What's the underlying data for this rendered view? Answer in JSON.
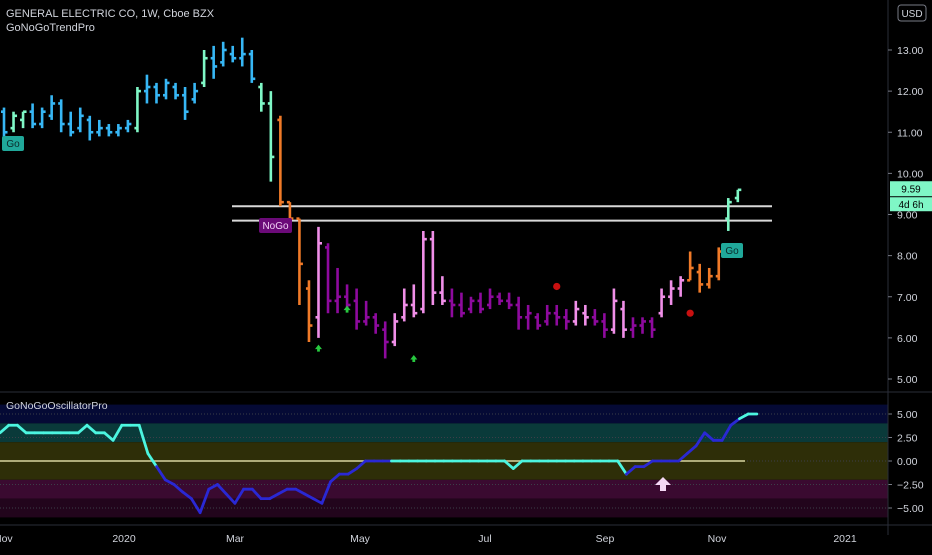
{
  "header": {
    "symbol_line": "GENERAL ELECTRIC CO, 1W, Cboe BZX",
    "indicator": "GoNoGoTrendPro",
    "currency_button": "USD"
  },
  "oscillator": {
    "title": "GoNoGoOscillatorPro"
  },
  "colors": {
    "go_strong": "#37b7f5",
    "go": "#7ff7c6",
    "nogo": "#8e0a9e",
    "nogo_weak": "#f08fe8",
    "nogo_orange": "#f07a28",
    "osc_line_go": "#4cf5e0",
    "osc_line_nogo": "#2a28d4"
  },
  "chart_data": [
    {
      "type": "ohlc",
      "title": "GENERAL ELECTRIC CO, 1W, Cboe BZX",
      "x_labels": [
        "Nov",
        "2020",
        "Mar",
        "May",
        "Jul",
        "Sep",
        "Nov",
        "2021"
      ],
      "y_ticks": [
        5.0,
        6.0,
        7.0,
        8.0,
        9.0,
        10.0,
        11.0,
        12.0,
        13.0
      ],
      "ylim": [
        4.7,
        13.7
      ],
      "last_price": "9.59",
      "countdown": "4d 6h",
      "resistance_zone": [
        8.85,
        9.2
      ],
      "labels": [
        {
          "text": "Go",
          "bar": 0
        },
        {
          "text": "NoGo",
          "bar": 33
        },
        {
          "text": "Go",
          "bar": 104
        }
      ],
      "bars": [
        {
          "h": 11.6,
          "l": 10.8,
          "o": 11.5,
          "c": 11.0,
          "t": "go_strong"
        },
        {
          "h": 11.5,
          "l": 11.0,
          "o": 11.1,
          "c": 11.4,
          "t": "go"
        },
        {
          "h": 11.5,
          "l": 11.1,
          "o": 11.3,
          "c": 11.5,
          "t": "go"
        },
        {
          "h": 11.7,
          "l": 11.1,
          "o": 11.5,
          "c": 11.2,
          "t": "go_strong"
        },
        {
          "h": 11.6,
          "l": 11.1,
          "o": 11.2,
          "c": 11.5,
          "t": "go_strong"
        },
        {
          "h": 11.9,
          "l": 11.3,
          "o": 11.4,
          "c": 11.7,
          "t": "go_strong"
        },
        {
          "h": 11.8,
          "l": 11.0,
          "o": 11.7,
          "c": 11.2,
          "t": "go_strong"
        },
        {
          "h": 11.5,
          "l": 10.9,
          "o": 11.2,
          "c": 11.0,
          "t": "go_strong"
        },
        {
          "h": 11.6,
          "l": 11.0,
          "o": 11.1,
          "c": 11.4,
          "t": "go_strong"
        },
        {
          "h": 11.4,
          "l": 10.8,
          "o": 11.3,
          "c": 11.0,
          "t": "go_strong"
        },
        {
          "h": 11.3,
          "l": 10.9,
          "o": 11.0,
          "c": 11.1,
          "t": "go_strong"
        },
        {
          "h": 11.2,
          "l": 10.9,
          "o": 11.1,
          "c": 11.0,
          "t": "go_strong"
        },
        {
          "h": 11.2,
          "l": 10.9,
          "o": 11.0,
          "c": 11.1,
          "t": "go_strong"
        },
        {
          "h": 11.3,
          "l": 11.0,
          "o": 11.1,
          "c": 11.2,
          "t": "go_strong"
        },
        {
          "h": 12.1,
          "l": 11.0,
          "o": 11.1,
          "c": 12.0,
          "t": "go"
        },
        {
          "h": 12.4,
          "l": 11.7,
          "o": 12.0,
          "c": 12.1,
          "t": "go_strong"
        },
        {
          "h": 12.2,
          "l": 11.7,
          "o": 12.1,
          "c": 11.9,
          "t": "go_strong"
        },
        {
          "h": 12.3,
          "l": 11.8,
          "o": 11.9,
          "c": 12.2,
          "t": "go_strong"
        },
        {
          "h": 12.2,
          "l": 11.8,
          "o": 12.1,
          "c": 11.9,
          "t": "go_strong"
        },
        {
          "h": 12.1,
          "l": 11.3,
          "o": 11.9,
          "c": 11.5,
          "t": "go_strong"
        },
        {
          "h": 12.2,
          "l": 11.7,
          "o": 11.8,
          "c": 12.0,
          "t": "go_strong"
        },
        {
          "h": 13.0,
          "l": 12.1,
          "o": 12.2,
          "c": 12.8,
          "t": "go"
        },
        {
          "h": 13.1,
          "l": 12.3,
          "o": 12.8,
          "c": 12.6,
          "t": "go_strong"
        },
        {
          "h": 13.2,
          "l": 12.6,
          "o": 12.7,
          "c": 13.0,
          "t": "go_strong"
        },
        {
          "h": 13.1,
          "l": 12.7,
          "o": 12.9,
          "c": 12.8,
          "t": "go_strong"
        },
        {
          "h": 13.3,
          "l": 12.6,
          "o": 12.8,
          "c": 12.9,
          "t": "go_strong"
        },
        {
          "h": 13.0,
          "l": 12.2,
          "o": 12.9,
          "c": 12.3,
          "t": "go_strong"
        },
        {
          "h": 12.2,
          "l": 11.5,
          "o": 12.1,
          "c": 11.7,
          "t": "go"
        },
        {
          "h": 12.0,
          "l": 9.8,
          "o": 11.7,
          "c": 10.4,
          "t": "go"
        },
        {
          "h": 11.4,
          "l": 9.2,
          "o": 11.3,
          "c": 9.3,
          "t": "nogo_orange"
        },
        {
          "h": 9.3,
          "l": 8.8,
          "o": 9.3,
          "c": 8.9,
          "t": "nogo_orange"
        },
        {
          "h": 8.9,
          "l": 6.8,
          "o": 8.9,
          "c": 7.8,
          "t": "nogo_orange"
        },
        {
          "h": 7.4,
          "l": 5.9,
          "o": 7.2,
          "c": 6.3,
          "t": "nogo_orange"
        },
        {
          "h": 8.7,
          "l": 6.0,
          "o": 6.5,
          "c": 8.3,
          "t": "nogo_weak"
        },
        {
          "h": 8.3,
          "l": 6.6,
          "o": 8.2,
          "c": 6.9,
          "t": "nogo"
        },
        {
          "h": 7.7,
          "l": 6.6,
          "o": 6.9,
          "c": 7.0,
          "t": "nogo"
        },
        {
          "h": 7.3,
          "l": 6.7,
          "o": 7.0,
          "c": 6.8,
          "t": "nogo"
        },
        {
          "h": 7.2,
          "l": 6.2,
          "o": 6.9,
          "c": 6.4,
          "t": "nogo"
        },
        {
          "h": 6.9,
          "l": 6.3,
          "o": 6.4,
          "c": 6.5,
          "t": "nogo"
        },
        {
          "h": 6.6,
          "l": 6.1,
          "o": 6.5,
          "c": 6.3,
          "t": "nogo"
        },
        {
          "h": 6.4,
          "l": 5.5,
          "o": 6.2,
          "c": 5.9,
          "t": "nogo"
        },
        {
          "h": 6.6,
          "l": 5.8,
          "o": 5.9,
          "c": 6.4,
          "t": "nogo_weak"
        },
        {
          "h": 7.2,
          "l": 6.4,
          "o": 6.5,
          "c": 6.8,
          "t": "nogo_weak"
        },
        {
          "h": 7.3,
          "l": 6.5,
          "o": 6.8,
          "c": 6.6,
          "t": "nogo_weak"
        },
        {
          "h": 8.6,
          "l": 6.6,
          "o": 6.7,
          "c": 8.4,
          "t": "nogo_weak"
        },
        {
          "h": 8.6,
          "l": 6.8,
          "o": 8.4,
          "c": 7.1,
          "t": "nogo_weak"
        },
        {
          "h": 7.5,
          "l": 6.8,
          "o": 7.1,
          "c": 6.9,
          "t": "nogo_weak"
        },
        {
          "h": 7.2,
          "l": 6.5,
          "o": 6.9,
          "c": 6.8,
          "t": "nogo"
        },
        {
          "h": 7.1,
          "l": 6.5,
          "o": 6.8,
          "c": 6.6,
          "t": "nogo"
        },
        {
          "h": 7.0,
          "l": 6.6,
          "o": 6.7,
          "c": 6.9,
          "t": "nogo"
        },
        {
          "h": 7.1,
          "l": 6.6,
          "o": 6.9,
          "c": 6.7,
          "t": "nogo"
        },
        {
          "h": 7.2,
          "l": 6.7,
          "o": 6.8,
          "c": 7.0,
          "t": "nogo"
        },
        {
          "h": 7.1,
          "l": 6.8,
          "o": 7.0,
          "c": 6.9,
          "t": "nogo"
        },
        {
          "h": 7.1,
          "l": 6.7,
          "o": 6.9,
          "c": 6.8,
          "t": "nogo"
        },
        {
          "h": 7.0,
          "l": 6.2,
          "o": 6.8,
          "c": 6.5,
          "t": "nogo"
        },
        {
          "h": 6.8,
          "l": 6.2,
          "o": 6.5,
          "c": 6.6,
          "t": "nogo"
        },
        {
          "h": 6.6,
          "l": 6.2,
          "o": 6.5,
          "c": 6.3,
          "t": "nogo"
        },
        {
          "h": 6.8,
          "l": 6.3,
          "o": 6.4,
          "c": 6.6,
          "t": "nogo"
        },
        {
          "h": 6.8,
          "l": 6.3,
          "o": 6.6,
          "c": 6.5,
          "t": "nogo"
        },
        {
          "h": 6.7,
          "l": 6.2,
          "o": 6.5,
          "c": 6.4,
          "t": "nogo"
        },
        {
          "h": 6.9,
          "l": 6.3,
          "o": 6.4,
          "c": 6.7,
          "t": "nogo_weak"
        },
        {
          "h": 6.8,
          "l": 6.3,
          "o": 6.6,
          "c": 6.5,
          "t": "nogo_weak"
        },
        {
          "h": 6.7,
          "l": 6.3,
          "o": 6.5,
          "c": 6.4,
          "t": "nogo"
        },
        {
          "h": 6.6,
          "l": 6.0,
          "o": 6.4,
          "c": 6.2,
          "t": "nogo"
        },
        {
          "h": 7.2,
          "l": 6.1,
          "o": 6.2,
          "c": 6.9,
          "t": "nogo_weak"
        },
        {
          "h": 6.9,
          "l": 6.0,
          "o": 6.7,
          "c": 6.2,
          "t": "nogo_weak"
        },
        {
          "h": 6.5,
          "l": 6.0,
          "o": 6.2,
          "c": 6.3,
          "t": "nogo"
        },
        {
          "h": 6.5,
          "l": 6.1,
          "o": 6.3,
          "c": 6.4,
          "t": "nogo"
        },
        {
          "h": 6.5,
          "l": 6.0,
          "o": 6.4,
          "c": 6.2,
          "t": "nogo"
        },
        {
          "h": 7.2,
          "l": 6.5,
          "o": 6.6,
          "c": 7.0,
          "t": "nogo_weak"
        },
        {
          "h": 7.4,
          "l": 6.8,
          "o": 7.0,
          "c": 7.2,
          "t": "nogo_weak"
        },
        {
          "h": 7.5,
          "l": 7.0,
          "o": 7.2,
          "c": 7.4,
          "t": "nogo_weak"
        },
        {
          "h": 8.1,
          "l": 7.4,
          "o": 7.4,
          "c": 7.7,
          "t": "nogo_orange"
        },
        {
          "h": 7.8,
          "l": 7.1,
          "o": 7.6,
          "c": 7.3,
          "t": "nogo_orange"
        },
        {
          "h": 7.7,
          "l": 7.2,
          "o": 7.3,
          "c": 7.5,
          "t": "nogo_orange"
        },
        {
          "h": 8.2,
          "l": 7.4,
          "o": 7.5,
          "c": 8.1,
          "t": "nogo_orange"
        },
        {
          "h": 9.4,
          "l": 8.6,
          "o": 8.9,
          "c": 9.3,
          "t": "go"
        },
        {
          "h": 9.6,
          "l": 9.3,
          "o": 9.4,
          "c": 9.6,
          "t": "go"
        }
      ],
      "bars_note": "",
      "go_arrows": [
        {
          "bar": 33,
          "y": 5.75
        },
        {
          "bar": 36,
          "y": 6.7
        },
        {
          "bar": 43,
          "y": 5.5
        }
      ],
      "nogo_dots": [
        {
          "bar": 58,
          "y": 7.25
        },
        {
          "bar": 72,
          "y": 6.6
        }
      ]
    },
    {
      "type": "line",
      "title": "GoNoGoOscillatorPro",
      "y_ticks": [
        5.0,
        2.5,
        0.0,
        -2.5,
        -5.0
      ],
      "ylim": [
        -6.2,
        6.2
      ],
      "zero_line": 0.0,
      "values": [
        3,
        3.8,
        3.8,
        3,
        3,
        3,
        3,
        3,
        3,
        3,
        3.8,
        3,
        3,
        2.2,
        3.8,
        3.8,
        3.8,
        0.8,
        -0.6,
        -2,
        -2.5,
        -3.3,
        -4,
        -5.5,
        -3,
        -2.5,
        -3.5,
        -4.5,
        -3,
        -3,
        -4,
        -4,
        -3.5,
        -3,
        -3,
        -3.5,
        -4,
        -4.5,
        -2.2,
        -1.4,
        -1.4,
        -0.8,
        0,
        0,
        0,
        0,
        0,
        0,
        0,
        0,
        0,
        0,
        0,
        0,
        0,
        0,
        0,
        0,
        0,
        -0.8,
        0,
        0,
        0,
        0,
        0,
        0,
        0,
        0,
        0,
        0,
        0,
        0,
        -1.4,
        -0.6,
        -0.6,
        0,
        0,
        0,
        0,
        0.8,
        1.6,
        3.0,
        2.2,
        2.2,
        3.8,
        4.5,
        5.0,
        5.0
      ],
      "segment_trend": [
        1,
        1,
        1,
        1,
        1,
        1,
        1,
        1,
        1,
        1,
        1,
        1,
        1,
        1,
        1,
        1,
        1,
        1,
        0,
        0,
        0,
        0,
        0,
        0,
        0,
        0,
        0,
        0,
        0,
        0,
        0,
        0,
        0,
        0,
        0,
        0,
        0,
        0,
        0,
        0,
        0,
        0,
        0,
        0,
        0,
        1,
        1,
        1,
        1,
        1,
        1,
        1,
        1,
        1,
        1,
        1,
        1,
        1,
        1,
        1,
        1,
        1,
        1,
        1,
        1,
        1,
        1,
        1,
        1,
        1,
        1,
        1,
        0,
        0,
        0,
        0,
        0,
        0,
        0,
        0,
        0,
        0,
        0,
        0,
        0,
        1,
        1,
        1
      ],
      "up_arrow_index": 76
    }
  ]
}
